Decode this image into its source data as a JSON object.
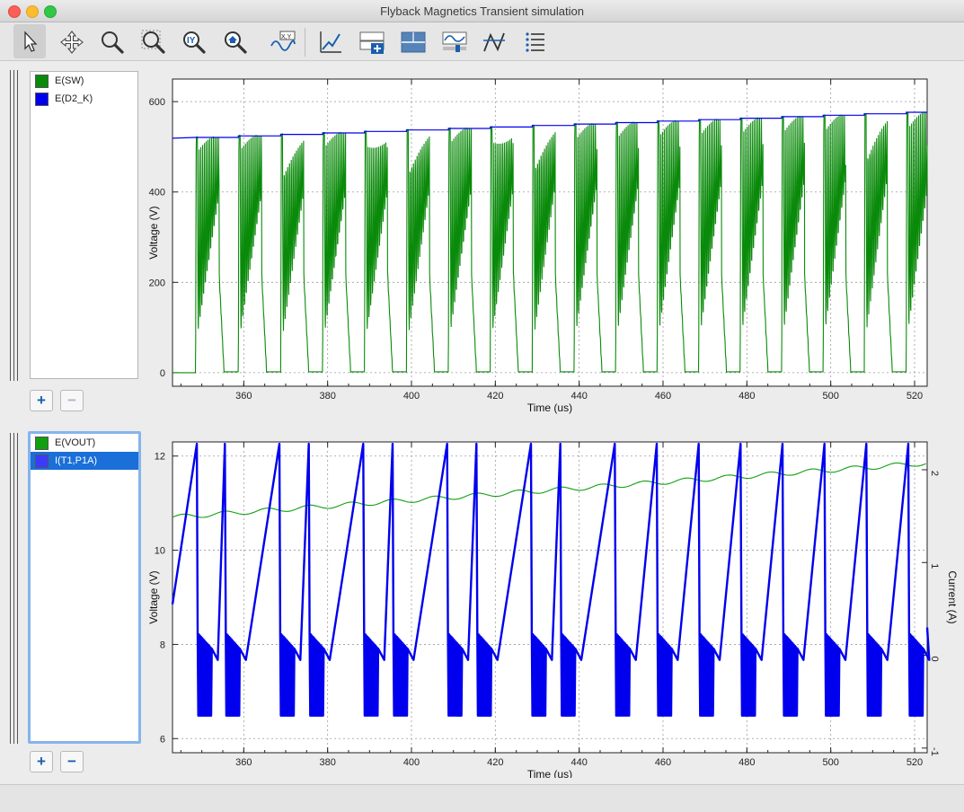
{
  "window": {
    "title": "Flyback Magnetics Transient simulation"
  },
  "toolbar": {
    "tools": [
      "pointer-icon",
      "pan-icon",
      "zoom-icon",
      "zoom-box-icon",
      "zoom-y-icon",
      "zoom-fit-icon",
      "xy-plot-icon",
      "add-plot-icon",
      "add-pane-icon",
      "pane-layout-icon",
      "signal-settings-icon",
      "cursor-icon",
      "list-icon"
    ]
  },
  "panes": [
    {
      "legend": [
        {
          "label": "E(SW)",
          "color": "#0a8a0a"
        },
        {
          "label": "E(D2_K)",
          "color": "#0000ee"
        }
      ],
      "buttons": {
        "add": "+",
        "remove": "−"
      },
      "chart": {
        "xlabel": "Time (us)",
        "ylabel": "Voltage (V)",
        "xticks": [
          "360",
          "380",
          "400",
          "420",
          "440",
          "460",
          "480",
          "500",
          "520"
        ],
        "yticks": [
          "0",
          "200",
          "400",
          "600"
        ]
      }
    },
    {
      "legend": [
        {
          "label": "E(VOUT)",
          "color": "#10a010"
        },
        {
          "label": "I(T1,P1A)",
          "color": "#3b3bff"
        }
      ],
      "buttons": {
        "add": "+",
        "remove": "−"
      },
      "chart": {
        "xlabel": "Time (us)",
        "ylabel": "Voltage (V)",
        "y2label": "Current (A)",
        "xticks": [
          "360",
          "380",
          "400",
          "420",
          "440",
          "460",
          "480",
          "500",
          "520"
        ],
        "yticks": [
          "6",
          "8",
          "10",
          "12"
        ],
        "y2ticks": [
          "-1",
          "0",
          "1",
          "2"
        ]
      }
    }
  ],
  "chart_data": [
    {
      "type": "line",
      "x_range": [
        343,
        523
      ],
      "ylim": [
        -30,
        650
      ],
      "ylabel": "Voltage (V)",
      "xlabel": "Time (us)",
      "grid": true,
      "legend_placement": "separate-left-panel",
      "series": [
        {
          "name": "E(SW)",
          "color": "#0a8a0a",
          "note_shape": "switching square wave with ringing",
          "switch_on_times": [
            348.5,
            358.7,
            368.8,
            378.8,
            388.8,
            398.8,
            408.8,
            418.8,
            428.8,
            438.8,
            448.7,
            458.6,
            468.5,
            478.4,
            488.3,
            498.2,
            508.0,
            518.0
          ],
          "high_level_start": 520,
          "high_level_end": 578,
          "low_level": 0
        },
        {
          "name": "E(D2_K)",
          "color": "#0000ee",
          "x": [
            343,
            523
          ],
          "y": [
            519,
            578
          ]
        }
      ]
    },
    {
      "type": "line",
      "x_range": [
        343,
        523
      ],
      "ylim": [
        5.7,
        12.3
      ],
      "y2lim": [
        -1.05,
        2.3
      ],
      "ylabel": "Voltage (V)",
      "y2label": "Current (A)",
      "xlabel": "Time (us)",
      "grid": true,
      "legend_placement": "separate-left-panel",
      "series": [
        {
          "name": "E(VOUT)",
          "color": "#10a010",
          "axis": "left",
          "x": [
            343,
            523
          ],
          "y": [
            10.7,
            11.85
          ]
        },
        {
          "name": "I(T1,P1A)",
          "color": "#0000ee",
          "axis": "right",
          "note_shape": "triangular ramp current with switching oscillations",
          "peak_times": [
            348.8,
            355.5,
            368.5,
            375.5,
            388.5,
            395.5,
            408.5,
            415.5,
            428.5,
            435.5,
            448.5,
            458.5,
            468.5,
            478.5,
            488.5,
            498.5,
            508.5,
            518.5
          ],
          "peak_current": 2.28,
          "valley_current": -0.65
        }
      ]
    }
  ]
}
